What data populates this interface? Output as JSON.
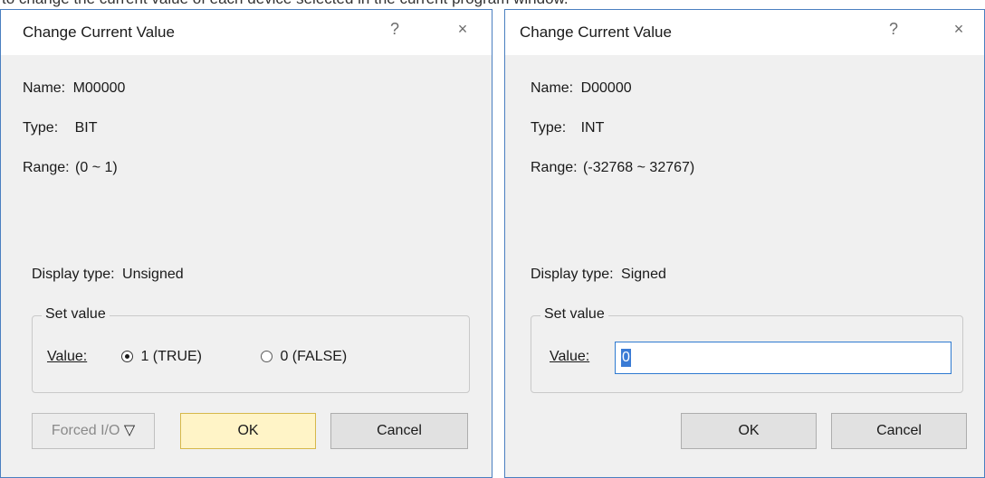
{
  "top_text": "to change the current value of each device selected in the current program window.",
  "dialog1": {
    "title": "Change Current Value",
    "help_label": "?",
    "close_label": "×",
    "name_label": "Name:",
    "name_value": "M00000",
    "type_label": "Type:",
    "type_value": "BIT",
    "range_label": "Range:",
    "range_value": "(0 ~ 1)",
    "display_type_label": "Display type:",
    "display_type_value": "Unsigned",
    "set_value_group": "Set value",
    "value_label": "Value:",
    "radio_true_label": "1 (TRUE)",
    "radio_false_label": "0 (FALSE)",
    "selected": "1 (TRUE)",
    "forced_io_label": "Forced I/O",
    "ok_label": "OK",
    "cancel_label": "Cancel"
  },
  "dialog2": {
    "title": "Change Current Value",
    "help_label": "?",
    "close_label": "×",
    "name_label": "Name:",
    "name_value": "D00000",
    "type_label": "Type:",
    "type_value": "INT",
    "range_label": "Range:",
    "range_value": "(-32768 ~ 32767)",
    "display_type_label": "Display type:",
    "display_type_value": "Signed",
    "set_value_group": "Set value",
    "value_label": "Value:",
    "value_input": "0",
    "ok_label": "OK",
    "cancel_label": "Cancel"
  },
  "colors": {
    "dialog_bg": "#f0f0f0",
    "titlebar_bg": "#ffffff",
    "border": "#4a7fc0",
    "ok_highlight": "#fff4c7",
    "input_border": "#2f7ad0",
    "selection": "#3a7bd5"
  }
}
